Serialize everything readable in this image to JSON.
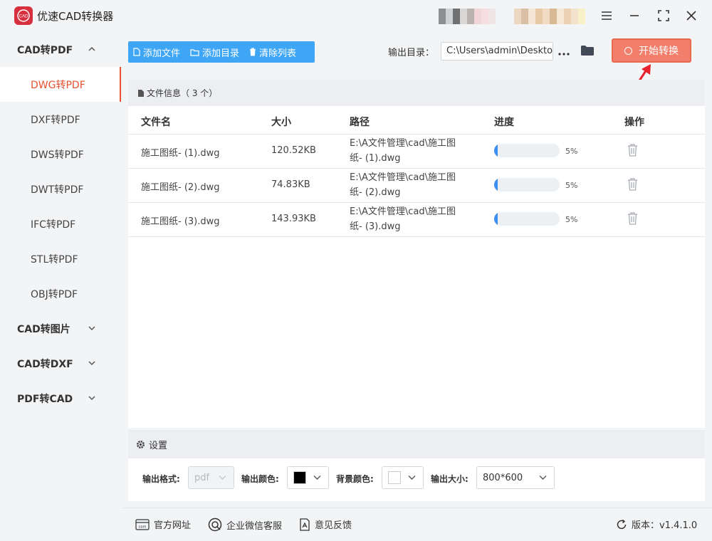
{
  "app": {
    "title": "优速CAD转换器",
    "logo_text": "CAD"
  },
  "window": {
    "menu_icon": "hamburger-icon",
    "minimize_icon": "minimize-icon",
    "maximize_icon": "maximize-icon",
    "close_icon": "close-icon"
  },
  "sidebar": {
    "groups": [
      {
        "label": "CAD转PDF",
        "expanded": true,
        "items": [
          "DWG转PDF",
          "DXF转PDF",
          "DWS转PDF",
          "DWT转PDF",
          "IFC转PDF",
          "STL转PDF",
          "OBJ转PDF"
        ],
        "active_item": "DWG转PDF"
      },
      {
        "label": "CAD转图片",
        "expanded": false
      },
      {
        "label": "CAD转DXF",
        "expanded": false
      },
      {
        "label": "PDF转CAD",
        "expanded": false
      }
    ]
  },
  "toolbar": {
    "add_file": "添加文件",
    "add_folder": "添加目录",
    "clear_list": "清除列表"
  },
  "output": {
    "label": "输出目录：",
    "path": "C:\\Users\\admin\\Deskto",
    "more": "···"
  },
  "start_button": {
    "label": "开始转换"
  },
  "file_panel": {
    "title": "文件信息（ 3 个）",
    "columns": {
      "name": "文件名",
      "size": "大小",
      "path": "路径",
      "progress": "进度",
      "action": "操作"
    },
    "rows": [
      {
        "name": "施工图纸- (1).dwg",
        "size": "120.52KB",
        "path_line1": "E:\\A文件管理\\cad\\施工图",
        "path_line2": "纸- (1).dwg",
        "progress": 5,
        "progress_text": "5%"
      },
      {
        "name": "施工图纸- (2).dwg",
        "size": "74.83KB",
        "path_line1": "E:\\A文件管理\\cad\\施工图",
        "path_line2": "纸- (2).dwg",
        "progress": 5,
        "progress_text": "5%"
      },
      {
        "name": "施工图纸- (3).dwg",
        "size": "143.93KB",
        "path_line1": "E:\\A文件管理\\cad\\施工图",
        "path_line2": "纸- (3).dwg",
        "progress": 5,
        "progress_text": "5%"
      }
    ]
  },
  "settings": {
    "title": "设置",
    "format_label": "输出格式:",
    "format_value": "pdf",
    "color_label": "输出颜色:",
    "color_value": "#000000",
    "bg_label": "背景颜色:",
    "bg_value": "#ffffff",
    "size_label": "输出大小:",
    "size_value": "800*600"
  },
  "footer": {
    "website": "官方网址",
    "wechat": "企业微信客服",
    "feedback": "意见反馈",
    "version": "版本：v1.4.1.0"
  },
  "colors": {
    "accent": "#e8502f",
    "primary_blue": "#3fa6f5",
    "start_button": "#f17f6c",
    "progress": "#3b8ef0"
  }
}
